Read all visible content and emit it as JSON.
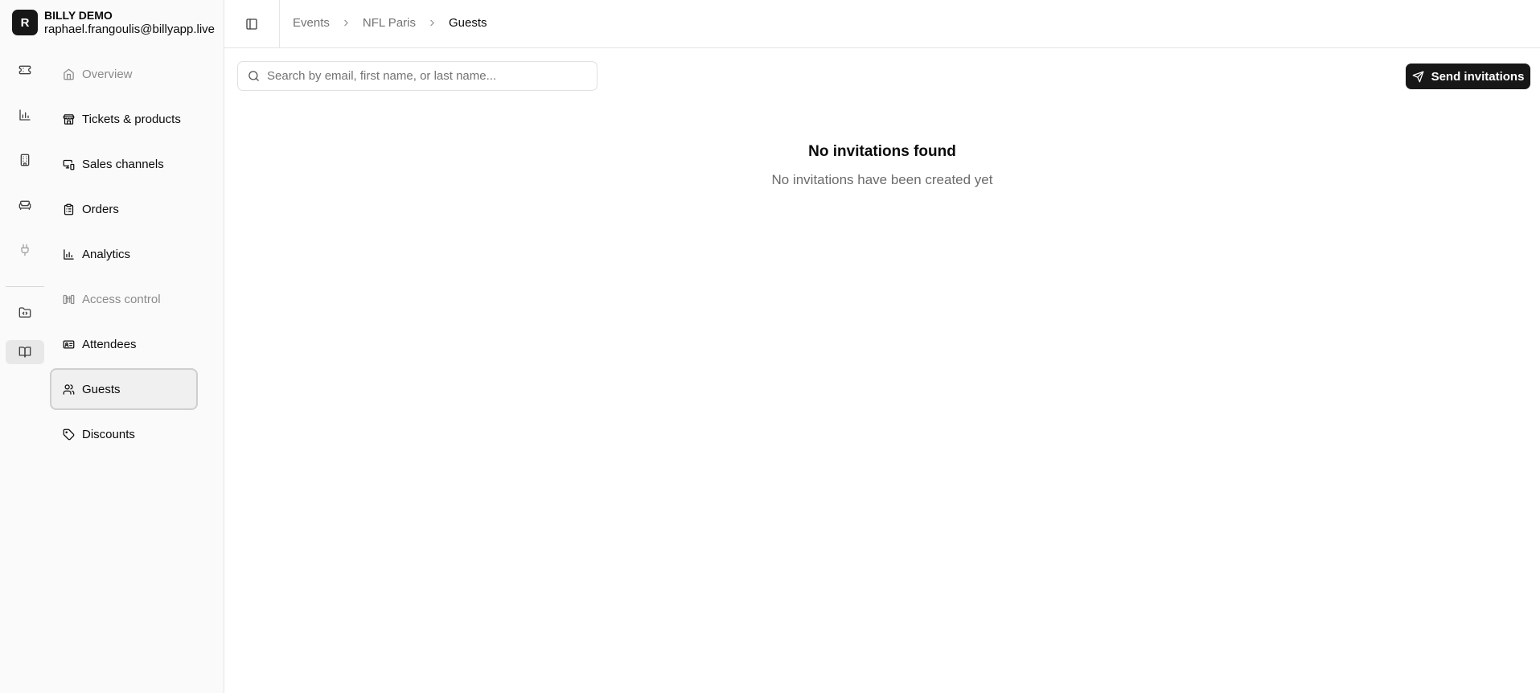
{
  "org": {
    "avatar_letter": "R",
    "name": "BILLY DEMO",
    "email": "raphael.frangoulis@billyapp.live"
  },
  "rail": {
    "items": [
      {
        "icon": "ticket-icon"
      },
      {
        "icon": "bar-chart-icon"
      },
      {
        "icon": "building-icon"
      },
      {
        "icon": "sofa-icon"
      },
      {
        "icon": "plug-icon"
      },
      {
        "icon": "folder-code-icon"
      },
      {
        "icon": "book-open-icon",
        "active": true
      }
    ]
  },
  "nav": {
    "items": [
      {
        "label": "Overview",
        "icon": "home-icon",
        "state": "disabled"
      },
      {
        "label": "Tickets & products",
        "icon": "store-icon"
      },
      {
        "label": "Sales channels",
        "icon": "devices-icon"
      },
      {
        "label": "Orders",
        "icon": "clipboard-list-icon"
      },
      {
        "label": "Analytics",
        "icon": "bar-chart-icon"
      },
      {
        "label": "Access control",
        "icon": "turnstile-icon",
        "state": "disabled"
      },
      {
        "label": "Attendees",
        "icon": "id-card-icon"
      },
      {
        "label": "Guests",
        "icon": "users-icon",
        "state": "active"
      },
      {
        "label": "Discounts",
        "icon": "tag-icon"
      }
    ]
  },
  "breadcrumb": {
    "items": [
      "Events",
      "NFL Paris",
      "Guests"
    ]
  },
  "search": {
    "placeholder": "Search by email, first name, or last name...",
    "value": ""
  },
  "actions": {
    "send_invitations_label": "Send invitations"
  },
  "empty_state": {
    "title": "No invitations found",
    "description": "No invitations have been created yet"
  },
  "colors": {
    "primary": "#171717",
    "sidebar_bg": "#fafafa",
    "muted_text": "#737373",
    "border": "#e5e5e5"
  }
}
